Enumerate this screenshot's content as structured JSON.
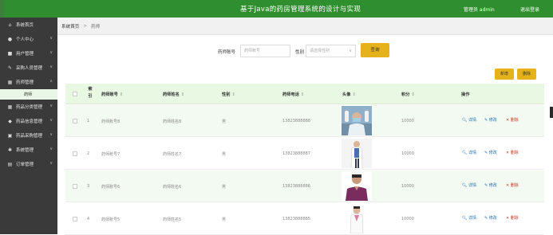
{
  "header": {
    "title": "基于Java的药房管理系统的设计与实现",
    "user_label": "管理员 admin",
    "logout_label": "退出登录"
  },
  "sidebar": {
    "items": [
      {
        "label": "系统首页",
        "icon": "home-icon",
        "chevron": ""
      },
      {
        "label": "个人中心",
        "icon": "user-icon",
        "chevron": "∨"
      },
      {
        "label": "用户管理",
        "icon": "users-icon",
        "chevron": "∨"
      },
      {
        "label": "采购人员管理",
        "icon": "buyer-icon",
        "chevron": "∨"
      },
      {
        "label": "药师管理",
        "icon": "pharmacist-icon",
        "chevron": "∧"
      },
      {
        "label": "药师",
        "sub": true
      },
      {
        "label": "药品分类管理",
        "icon": "category-icon",
        "chevron": "∨"
      },
      {
        "label": "药品信息管理",
        "icon": "info-icon",
        "chevron": "∨"
      },
      {
        "label": "药品采购管理",
        "icon": "purchase-icon",
        "chevron": "∨"
      },
      {
        "label": "系统管理",
        "icon": "gear-icon",
        "chevron": "∨"
      },
      {
        "label": "订单管理",
        "icon": "order-icon",
        "chevron": "∨"
      }
    ]
  },
  "breadcrumb": {
    "home": "系统首页",
    "arrow": ">",
    "current": "药师"
  },
  "search": {
    "account_label": "药师账号",
    "account_placeholder": "药师账号",
    "gender_label": "性别",
    "gender_placeholder": "请选择性别",
    "gender_dd": "∨",
    "button": "查询"
  },
  "toolbar": {
    "add_label": "新增",
    "delete_label": "删除"
  },
  "table": {
    "columns": {
      "index_line1": "索",
      "index_line2": "引",
      "account": "药师账号",
      "name": "药师姓名",
      "gender": "性别",
      "phone": "药师电话",
      "photo": "头像",
      "points": "积分",
      "actions": "操作"
    },
    "sort_icon": "⇕",
    "rows": [
      {
        "index": "1",
        "account": "药师账号8",
        "name": "药师姓名8",
        "gender": "男",
        "phone": "13823888888",
        "points": "10000"
      },
      {
        "index": "2",
        "account": "药师账号7",
        "name": "药师姓名7",
        "gender": "男",
        "phone": "13823888887",
        "points": "10000"
      },
      {
        "index": "3",
        "account": "药师账号6",
        "name": "药师姓名6",
        "gender": "男",
        "phone": "13823888886",
        "points": "10000"
      },
      {
        "index": "4",
        "account": "药师账号5",
        "name": "药师姓名5",
        "gender": "男",
        "phone": "13823888885",
        "points": "10000"
      }
    ],
    "actions": {
      "view": "详情",
      "edit": "修改",
      "delete": "删除"
    }
  }
}
